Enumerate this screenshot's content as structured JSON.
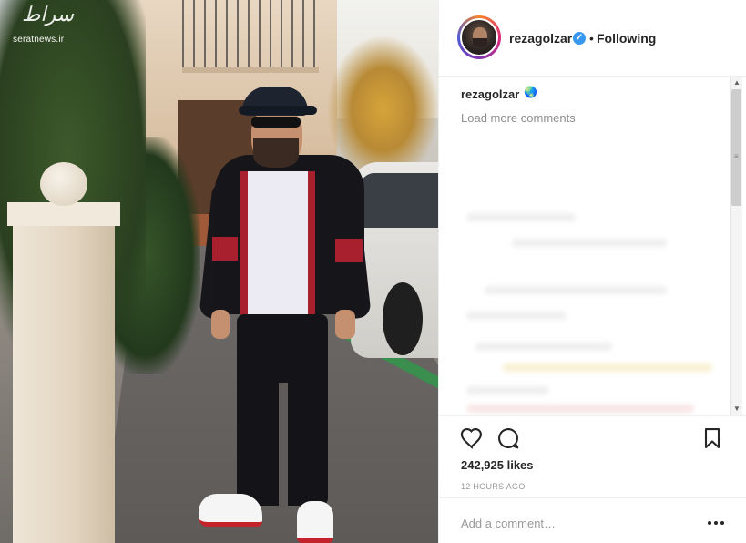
{
  "watermark": {
    "text": "seratnews.ir",
    "logo": "سراط"
  },
  "post": {
    "author": "rezagolzar",
    "verified": true,
    "follow_status": "Following",
    "separator": "•",
    "caption_user": "rezagolzar",
    "caption_emoji": "🌏",
    "load_more": "Load more comments",
    "likes": "242,925 likes",
    "time": "12 HOURS AGO",
    "comment_placeholder": "Add a comment…"
  },
  "icons": {
    "like": "heart-icon",
    "comment": "comment-bubble-icon",
    "save": "bookmark-icon",
    "more": "more-options-icon",
    "verified": "verified-badge-icon"
  },
  "colors": {
    "verified": "#3897f0",
    "text": "#262626",
    "muted": "#8e8e8e",
    "border": "#efefef"
  }
}
